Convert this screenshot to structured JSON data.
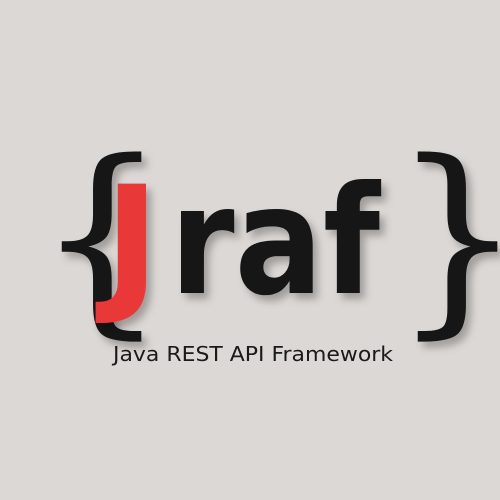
{
  "logo": {
    "brace_left": "{",
    "brace_right": "}",
    "letter_j": "J",
    "word_rest": "raf",
    "tagline": "Java REST API Framework"
  },
  "colors": {
    "background": "#dcd8d5",
    "letter_j": "#e83838",
    "text_dark": "#141414"
  }
}
